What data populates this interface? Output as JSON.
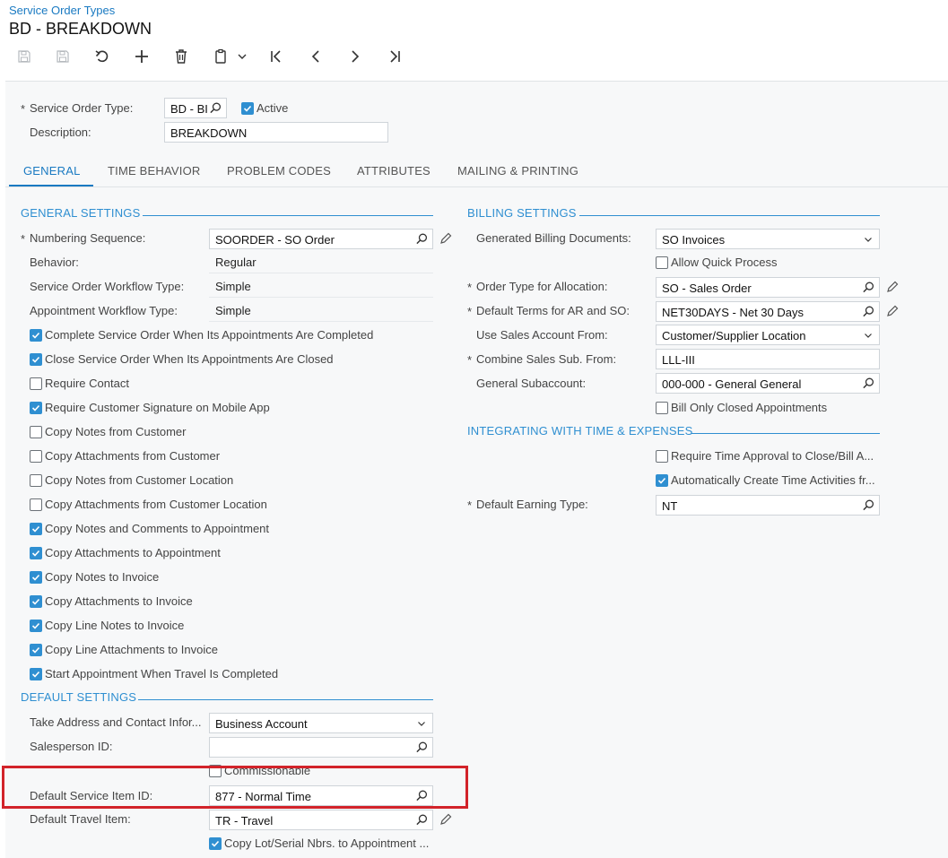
{
  "header": {
    "breadcrumb": "Service Order Types",
    "title": "BD - BREAKDOWN"
  },
  "toolbar": {
    "icons": [
      "save-icon",
      "save-close-icon",
      "undo-icon",
      "add-icon",
      "delete-icon",
      "copy-paste-icon",
      "first-icon",
      "previous-icon",
      "next-icon",
      "last-icon"
    ]
  },
  "form": {
    "req": "*",
    "service_order_type_label": "Service Order Type:",
    "service_order_type_value": "BD - BI",
    "active_label": "Active",
    "active_checked": true,
    "description_label": "Description:",
    "description_value": "BREAKDOWN"
  },
  "tabs": [
    "GENERAL",
    "TIME BEHAVIOR",
    "PROBLEM CODES",
    "ATTRIBUTES",
    "MAILING & PRINTING"
  ],
  "general_settings": {
    "title": "GENERAL SETTINGS",
    "numbering_sequence_label": "Numbering Sequence:",
    "numbering_sequence_value": "SOORDER - SO Order",
    "behavior_label": "Behavior:",
    "behavior_value": "Regular",
    "so_workflow_label": "Service Order Workflow Type:",
    "so_workflow_value": "Simple",
    "appt_workflow_label": "Appointment Workflow Type:",
    "appt_workflow_value": "Simple",
    "checkboxes": [
      {
        "label": "Complete Service Order When Its Appointments Are Completed",
        "checked": true
      },
      {
        "label": "Close Service Order When Its Appointments Are Closed",
        "checked": true
      },
      {
        "label": "Require Contact",
        "checked": false
      },
      {
        "label": "Require Customer Signature on Mobile App",
        "checked": true
      },
      {
        "label": "Copy Notes from Customer",
        "checked": false
      },
      {
        "label": "Copy Attachments from Customer",
        "checked": false
      },
      {
        "label": "Copy Notes from Customer Location",
        "checked": false
      },
      {
        "label": "Copy Attachments from Customer Location",
        "checked": false
      },
      {
        "label": "Copy Notes and Comments to Appointment",
        "checked": true
      },
      {
        "label": "Copy Attachments to Appointment",
        "checked": true
      },
      {
        "label": "Copy Notes to Invoice",
        "checked": true
      },
      {
        "label": "Copy Attachments to Invoice",
        "checked": true
      },
      {
        "label": "Copy Line Notes to Invoice",
        "checked": true
      },
      {
        "label": "Copy Line Attachments to Invoice",
        "checked": true
      },
      {
        "label": "Start Appointment When Travel Is Completed",
        "checked": true
      }
    ]
  },
  "default_settings": {
    "title": "DEFAULT SETTINGS",
    "take_address_label": "Take Address and Contact Infor...",
    "take_address_value": "Business Account",
    "salesperson_label": "Salesperson ID:",
    "salesperson_value": "",
    "commissionable_label": "Commissionable",
    "commissionable_checked": false,
    "default_service_item_label": "Default Service Item ID:",
    "default_service_item_value": "877 - Normal Time",
    "default_travel_item_label": "Default Travel Item:",
    "default_travel_item_value": "TR - Travel",
    "copy_lot_label": "Copy Lot/Serial Nbrs. to Appointment ...",
    "copy_lot_checked": true
  },
  "billing_settings": {
    "title": "BILLING SETTINGS",
    "generated_billing_label": "Generated Billing Documents:",
    "generated_billing_value": "SO Invoices",
    "allow_quick_label": "Allow Quick Process",
    "allow_quick_checked": false,
    "order_type_alloc_label": "Order Type for Allocation:",
    "order_type_alloc_value": "SO - Sales Order",
    "default_terms_label": "Default Terms for AR and SO:",
    "default_terms_value": "NET30DAYS - Net 30 Days",
    "use_sales_account_label": "Use Sales Account From:",
    "use_sales_account_value": "Customer/Supplier Location",
    "combine_sales_sub_label": "Combine Sales Sub. From:",
    "combine_sales_sub_value": "LLL-III",
    "general_subaccount_label": "General Subaccount:",
    "general_subaccount_value": "000-000 - General  General",
    "bill_only_closed_label": "Bill Only Closed Appointments",
    "bill_only_closed_checked": false
  },
  "time_expenses": {
    "title": "INTEGRATING WITH TIME & EXPENSES",
    "require_time_approval_label": "Require Time Approval to Close/Bill A...",
    "require_time_approval_checked": false,
    "auto_create_label": "Automatically Create Time Activities fr...",
    "auto_create_checked": true,
    "default_earning_label": "Default Earning Type:",
    "default_earning_value": "NT"
  },
  "colors": {
    "accent": "#2f8fd1",
    "link": "#1a7ac2",
    "highlight": "#d2232a",
    "panel_bg": "#f7f8f9"
  }
}
